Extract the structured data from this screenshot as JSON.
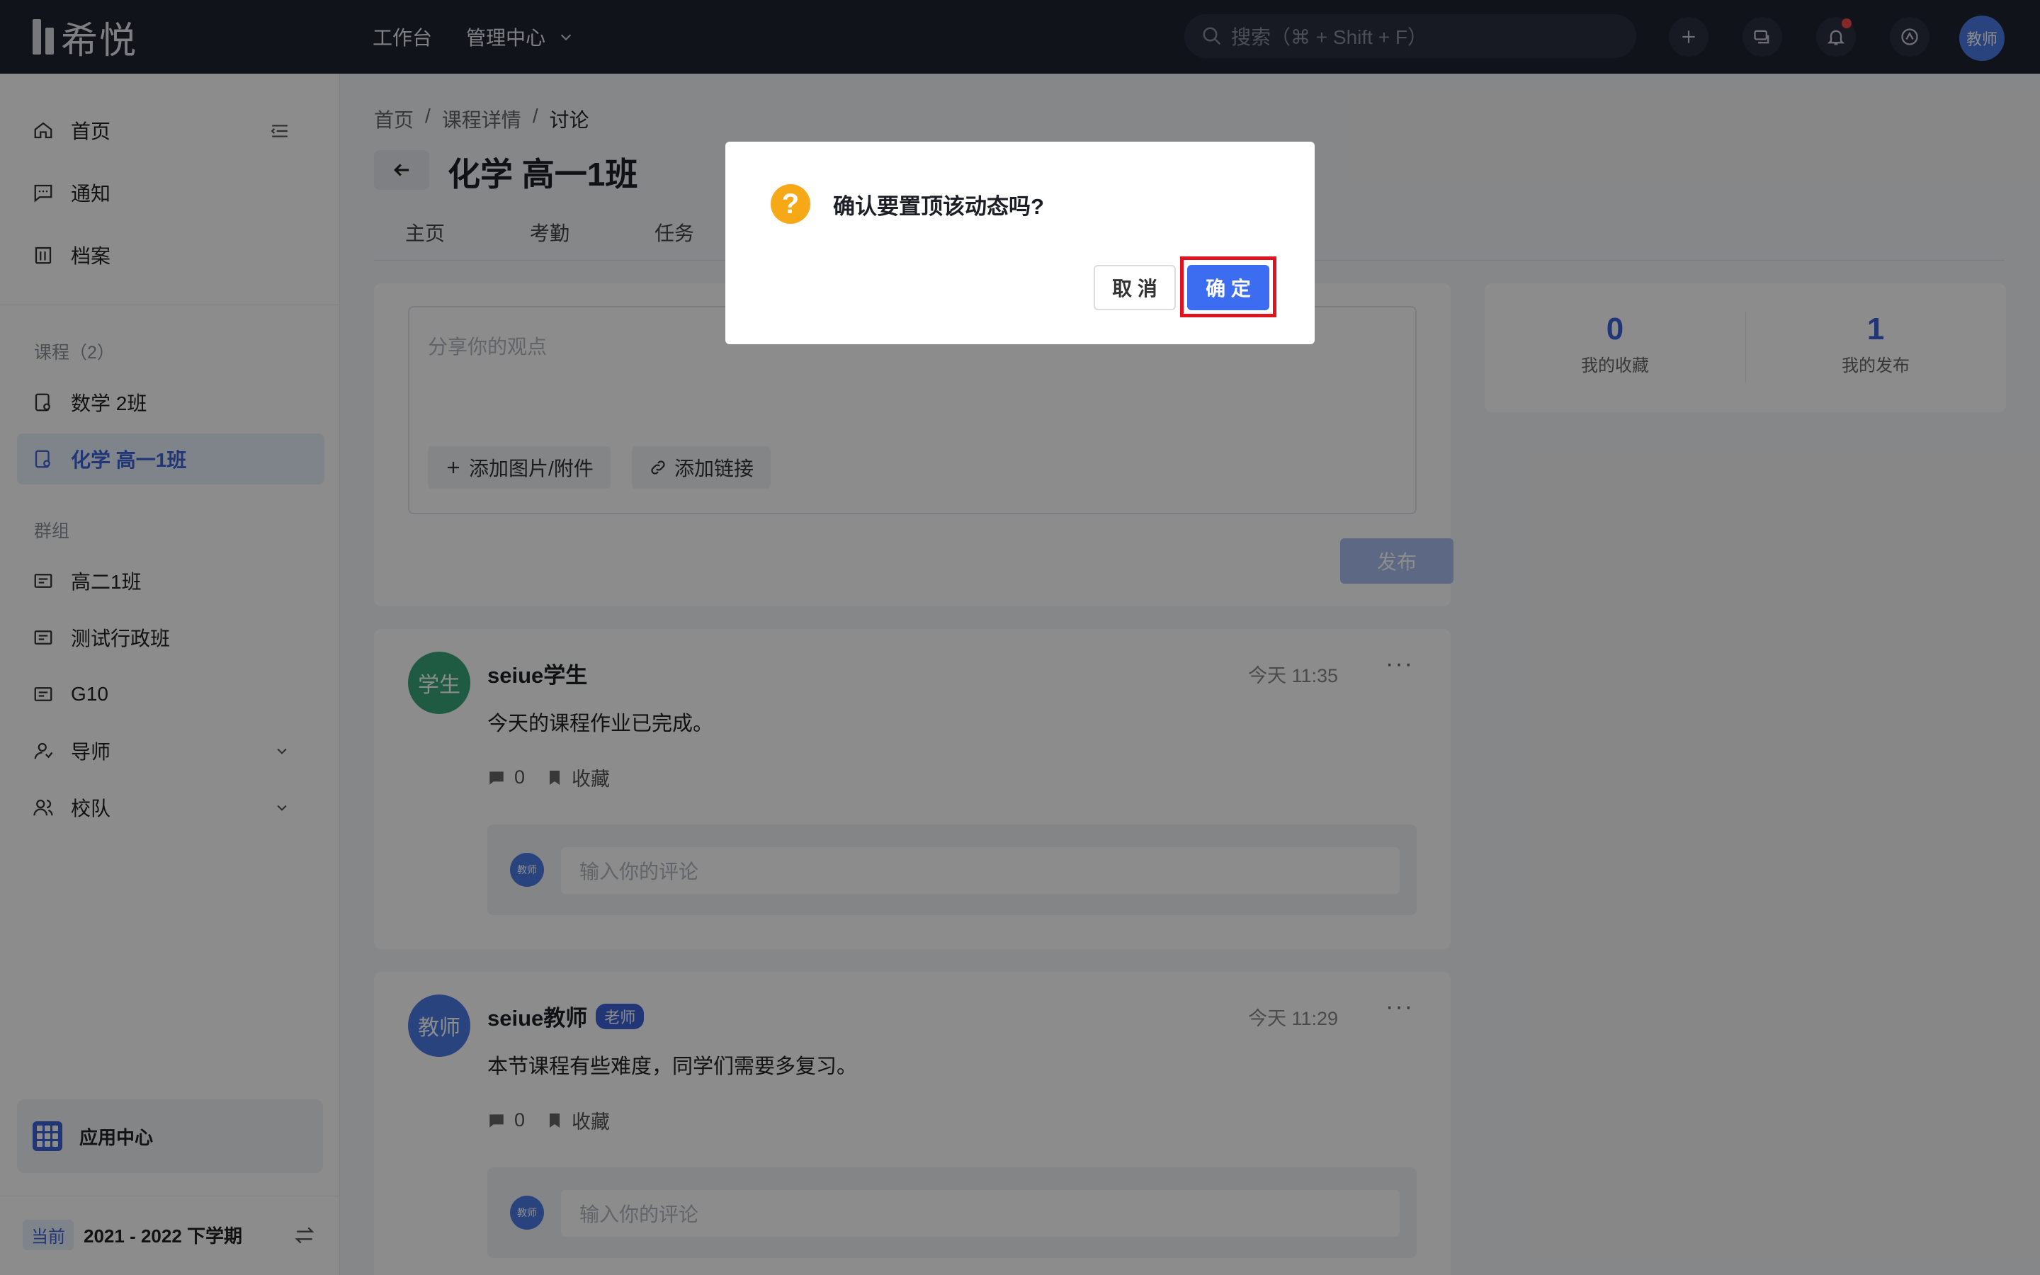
{
  "app": {
    "logo_text": "希悦"
  },
  "topbar": {
    "nav": [
      {
        "label": "工作台"
      },
      {
        "label": "管理中心"
      }
    ],
    "search_placeholder": "搜索（⌘ + Shift + F）",
    "user_avatar": "教师",
    "icons": [
      "plus-icon",
      "chat-icon",
      "bell-icon",
      "app-switch-icon"
    ]
  },
  "sidebar": {
    "main": [
      {
        "label": "首页"
      },
      {
        "label": "通知"
      },
      {
        "label": "档案"
      }
    ],
    "courses_title": "课程（2）",
    "courses": [
      {
        "label": "数学 2班"
      },
      {
        "label": "化学 高一1班",
        "active": true
      }
    ],
    "groups_title": "群组",
    "groups": [
      {
        "label": "高二1班"
      },
      {
        "label": "测试行政班"
      },
      {
        "label": "G10"
      },
      {
        "label": "导师"
      },
      {
        "label": "校队"
      }
    ],
    "app_center": "应用中心",
    "term_badge": "当前",
    "term": "2021 - 2022 下学期"
  },
  "breadcrumb": [
    "首页",
    "课程详情",
    "讨论"
  ],
  "breadcrumb_sep": "/",
  "page_title": "化学 高一1班",
  "tabs": [
    "主页",
    "考勤",
    "任务"
  ],
  "composer": {
    "placeholder": "分享你的观点",
    "add_attachment": "添加图片/附件",
    "add_link": "添加链接",
    "publish": "发布"
  },
  "stats": [
    {
      "value": "0",
      "label": "我的收藏"
    },
    {
      "value": "1",
      "label": "我的发布"
    }
  ],
  "posts": [
    {
      "avatar": "学生",
      "avatar_color": "#3aa57a",
      "author": "seiue学生",
      "time": "今天 11:35",
      "text": "今天的课程作业已完成。",
      "comments": "0",
      "favorite": "收藏",
      "comment_placeholder": "输入你的评论",
      "commenter": "教师"
    },
    {
      "avatar": "教师",
      "avatar_color": "#4b7be5",
      "author": "seiue教师",
      "badge": "老师",
      "time": "今天 11:29",
      "text": "本节课程有些难度，同学们需要多复习。",
      "comments": "0",
      "favorite": "收藏",
      "comment_placeholder": "输入你的评论",
      "commenter": "教师"
    }
  ],
  "dialog": {
    "message": "确认要置顶该动态吗?",
    "cancel": "取 消",
    "ok": "确 定"
  },
  "colors": {
    "accent": "#3c63d8",
    "topbar": "#1f2430",
    "warning": "#f7a816",
    "highlight": "#e0141e"
  }
}
